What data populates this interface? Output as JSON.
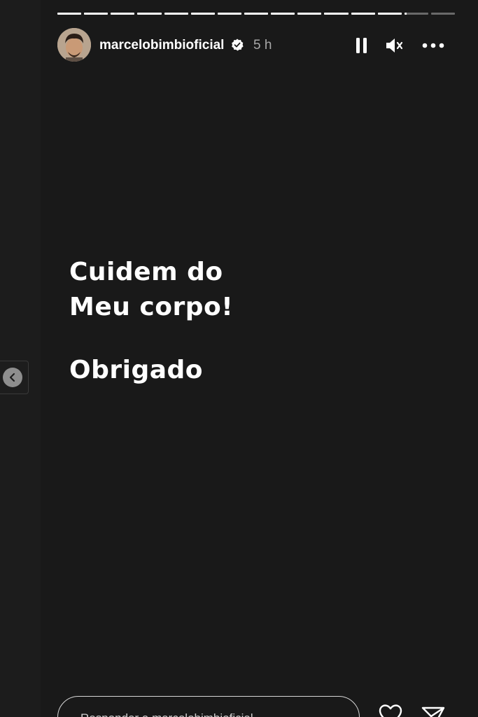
{
  "story": {
    "username": "marcelobimbioficial",
    "time": "5 h",
    "progress": {
      "segments": 15,
      "completed": 13,
      "current_fraction": 0.1
    },
    "text_lines": [
      "Cuidem do",
      "Meu corpo!",
      "Obrigado"
    ]
  },
  "reply": {
    "placeholder": "Responder a marcelobimbioficial..."
  },
  "icons": {
    "verified": "verified-badge-icon",
    "pause": "pause-icon",
    "mute": "muted-speaker-icon",
    "more": "more-options-icon",
    "prev": "chevron-left-icon",
    "like": "heart-icon",
    "share": "paper-plane-icon"
  },
  "colors": {
    "background": "#1a1a1a",
    "text": "#ffffff",
    "muted_text": "#a8a8a8"
  }
}
